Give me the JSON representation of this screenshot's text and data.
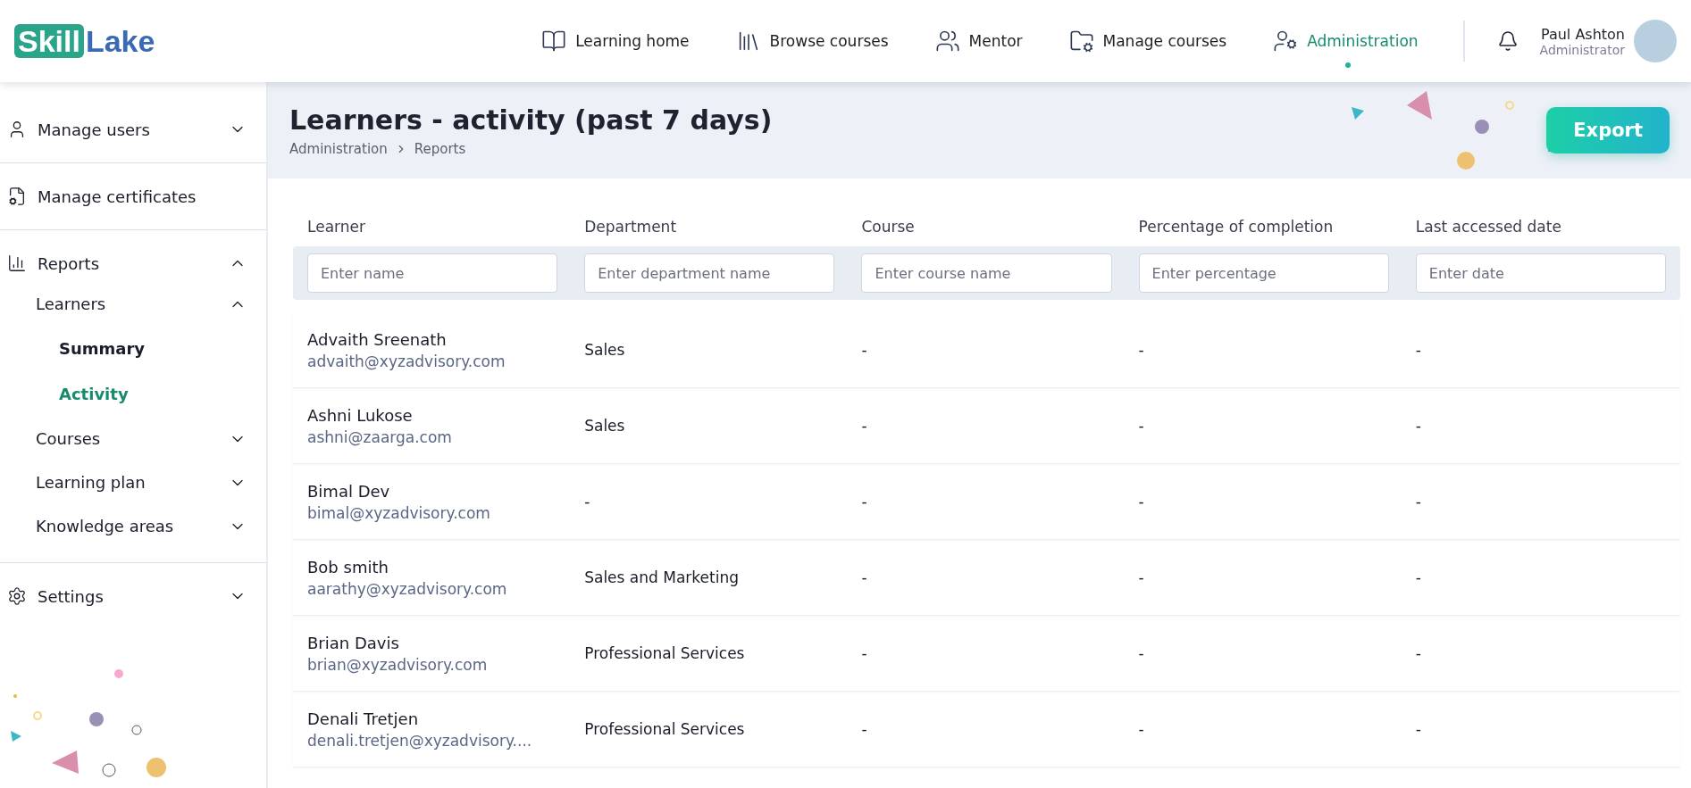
{
  "logo": {
    "part_1": "Skill",
    "part_2": "Lake"
  },
  "nav": [
    {
      "label": "Learning home",
      "kind": "reader",
      "selected": false
    },
    {
      "label": "Browse courses",
      "kind": "library",
      "selected": false
    },
    {
      "label": "Mentor",
      "kind": "people",
      "selected": false
    },
    {
      "label": "Manage courses",
      "kind": "folder",
      "selected": false
    },
    {
      "label": "Administration",
      "kind": "admin",
      "selected": true
    }
  ],
  "user": {
    "name": "Paul Ashton",
    "role": "Administrator"
  },
  "sidebar": {
    "items": [
      {
        "label": "Manage users",
        "kind": "user",
        "expanded": false
      },
      {
        "label": "Manage certificates",
        "kind": "certificate"
      },
      {
        "label": "Reports",
        "kind": "chart",
        "expanded": true,
        "children": [
          {
            "label": "Learners",
            "expanded": true,
            "children": [
              {
                "label": "Summary",
                "selected": false
              },
              {
                "label": "Activity",
                "selected": true
              }
            ]
          },
          {
            "label": "Courses",
            "expanded": false
          },
          {
            "label": "Learning plan",
            "expanded": false
          },
          {
            "label": "Knowledge areas",
            "expanded": false
          }
        ]
      },
      {
        "label": "Settings",
        "kind": "gear",
        "expanded": false
      }
    ]
  },
  "page": {
    "title": "Learners - activity (past 7 days)",
    "breadcrumb": [
      "Administration",
      "Reports"
    ],
    "export_button": "Export"
  },
  "table": {
    "columns": [
      {
        "label": "Learner",
        "placeholder": "Enter name"
      },
      {
        "label": "Department",
        "placeholder": "Enter department name"
      },
      {
        "label": "Course",
        "placeholder": "Enter course name"
      },
      {
        "label": "Percentage of completion",
        "placeholder": "Enter percentage"
      },
      {
        "label": "Last accessed date",
        "placeholder": "Enter date"
      }
    ],
    "rows": [
      {
        "name": "Advaith Sreenath",
        "email": "advaith@xyzadvisory.com",
        "department": "Sales",
        "course": "-",
        "percentage": "-",
        "last_accessed": "-"
      },
      {
        "name": "Ashni Lukose",
        "email": "ashni@zaarga.com",
        "department": "Sales",
        "course": "-",
        "percentage": "-",
        "last_accessed": "-"
      },
      {
        "name": "Bimal Dev",
        "email": "bimal@xyzadvisory.com",
        "department": "-",
        "course": "-",
        "percentage": "-",
        "last_accessed": "-"
      },
      {
        "name": "Bob smith",
        "email": "aarathy@xyzadvisory.com",
        "department": "Sales and Marketing",
        "course": "-",
        "percentage": "-",
        "last_accessed": "-"
      },
      {
        "name": "Brian Davis",
        "email": "brian@xyzadvisory.com",
        "department": "Professional Services",
        "course": "-",
        "percentage": "-",
        "last_accessed": "-"
      },
      {
        "name": "Denali Tretjen",
        "email": "denali.tretjen@xyzadvisory....",
        "department": "Professional Services",
        "course": "-",
        "percentage": "-",
        "last_accessed": "-"
      }
    ]
  }
}
